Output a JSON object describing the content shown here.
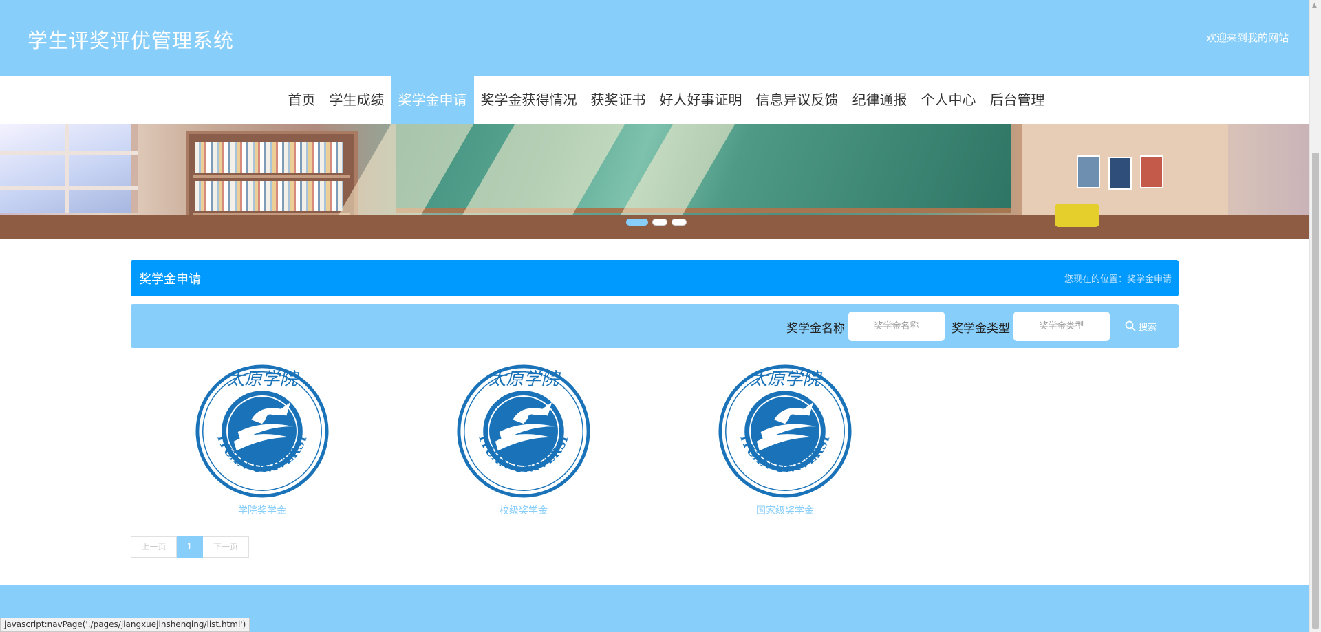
{
  "header": {
    "title": "学生评奖评优管理系统",
    "welcome": "欢迎来到我的网站"
  },
  "nav": {
    "items": [
      {
        "label": "首页"
      },
      {
        "label": "学生成绩"
      },
      {
        "label": "奖学金申请",
        "active": true
      },
      {
        "label": "奖学金获得情况"
      },
      {
        "label": "获奖证书"
      },
      {
        "label": "好人好事证明"
      },
      {
        "label": "信息异议反馈"
      },
      {
        "label": "纪律通报"
      },
      {
        "label": "个人中心"
      },
      {
        "label": "后台管理"
      }
    ]
  },
  "banner": {
    "image": "classroom-illustration",
    "slides": 3,
    "active_slide": 1
  },
  "section": {
    "title": "奖学金申请",
    "breadcrumb": "您现在的位置：奖学金申请"
  },
  "search": {
    "name_label": "奖学金名称",
    "name_placeholder": "奖学金名称",
    "type_label": "奖学金类型",
    "type_placeholder": "奖学金类型",
    "button_label": "搜索",
    "button_icon": "search-icon"
  },
  "scholarships": [
    {
      "name": "学院奖学金",
      "logo": "taiyuan-university-seal"
    },
    {
      "name": "校级奖学金",
      "logo": "taiyuan-university-seal"
    },
    {
      "name": "国家级奖学金",
      "logo": "taiyuan-university-seal"
    }
  ],
  "logo_text": {
    "top": "太原学院",
    "bottom": "TAIYUAN UNIVERSITY"
  },
  "pagination": {
    "prev": "上一页",
    "current": "1",
    "next": "下一页"
  },
  "status_bar": "javascript:navPage('./pages/jiangxuejinshenqing/list.html')",
  "colors": {
    "primary": "#87cefa",
    "accent": "#0099fe",
    "logo_blue": "#1a73b8"
  }
}
